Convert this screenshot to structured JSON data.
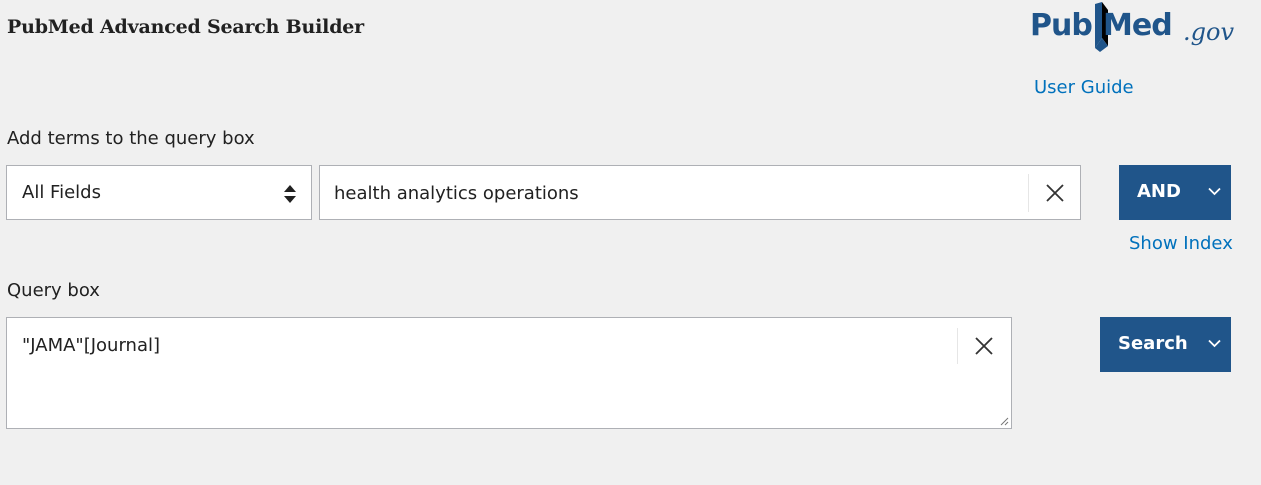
{
  "header": {
    "title": "PubMed Advanced Search Builder",
    "logo": {
      "pub": "Pub",
      "med": "Med",
      "gov": ".gov",
      "icon": "open-book-icon",
      "brand_color": "#20558a"
    },
    "user_guide_label": "User Guide"
  },
  "builder": {
    "add_terms_label": "Add terms to the query box",
    "field_selected": "All Fields",
    "term_value": "health analytics operations",
    "operator_label": "AND",
    "show_index_label": "Show Index"
  },
  "query": {
    "label": "Query box",
    "value": "\"JAMA\"[Journal]",
    "search_label": "Search"
  },
  "colors": {
    "button_bg": "#20558a",
    "link": "#0071bc",
    "background": "#f0f0f0"
  }
}
